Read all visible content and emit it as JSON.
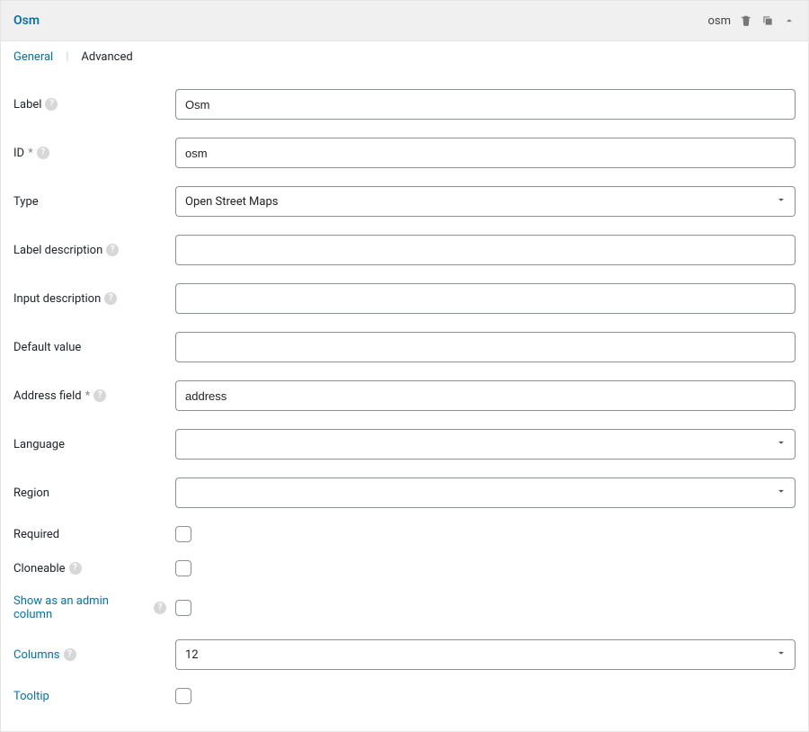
{
  "header": {
    "title": "Osm",
    "slug": "osm"
  },
  "tabs": {
    "general": "General",
    "advanced": "Advanced"
  },
  "icons": {
    "trash": "trash-icon",
    "duplicate": "duplicate-icon",
    "collapse": "collapse-icon"
  },
  "fields": {
    "label": {
      "label": "Label",
      "value": "Osm",
      "help": true
    },
    "id": {
      "label": "ID",
      "required": true,
      "value": "osm",
      "help": true
    },
    "type": {
      "label": "Type",
      "value": "Open Street Maps"
    },
    "label_desc": {
      "label": "Label description",
      "value": "",
      "help": true
    },
    "input_desc": {
      "label": "Input description",
      "value": "",
      "help": true
    },
    "default_value": {
      "label": "Default value",
      "value": ""
    },
    "address_field": {
      "label": "Address field",
      "required": true,
      "value": "address",
      "help": true
    },
    "language": {
      "label": "Language",
      "value": ""
    },
    "region": {
      "label": "Region",
      "value": ""
    },
    "required": {
      "label": "Required",
      "checked": false
    },
    "cloneable": {
      "label": "Cloneable",
      "checked": false,
      "help": true
    },
    "admin_column": {
      "label": "Show as an admin column",
      "checked": false,
      "help": true,
      "link": true
    },
    "columns": {
      "label": "Columns",
      "value": "12",
      "help": true,
      "link": true
    },
    "tooltip": {
      "label": "Tooltip",
      "checked": false,
      "link": true
    }
  }
}
